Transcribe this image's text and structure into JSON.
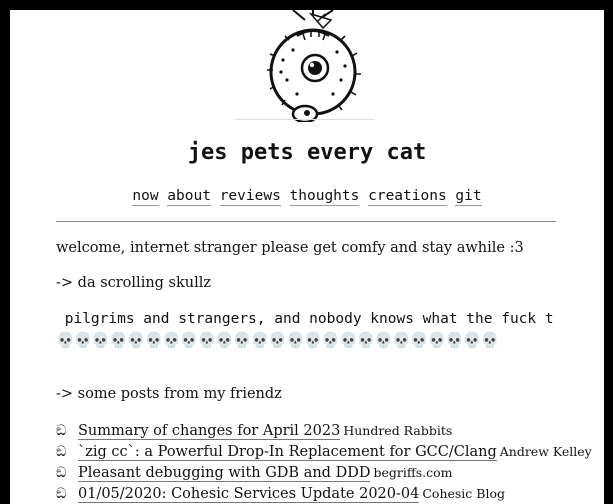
{
  "site": {
    "title": "jes pets every cat"
  },
  "nav": [
    "now",
    "about",
    "reviews",
    "thoughts",
    "creations",
    "git"
  ],
  "intro": {
    "welcome": "welcome, internet stranger please get comfy and stay awhile :3",
    "skulls_heading": "-> da scrolling skullz",
    "marquee_text": "pilgrims and strangers, and nobody knows what the fuck t",
    "skull_glyph": "💀",
    "skull_count": 25,
    "posts_heading": "-> some posts from my friendz"
  },
  "posts": [
    {
      "bullet": "ඞ",
      "title": "Summary of changes for April 2023",
      "source": "Hundred Rabbits"
    },
    {
      "bullet": "ඞ",
      "title": "`zig cc`: a Powerful Drop-In Replacement for GCC/Clang",
      "source": "Andrew Kelley"
    },
    {
      "bullet": "ඞ",
      "title": "Pleasant debugging with GDB and DDD",
      "source": "begriffs.com"
    },
    {
      "bullet": "ඞ",
      "title": "01/05/2020: Cohesic Services Update 2020-04",
      "source": "Cohesic Blog"
    }
  ],
  "icons": {
    "mascot": "pufferfish-mascot-icon"
  }
}
